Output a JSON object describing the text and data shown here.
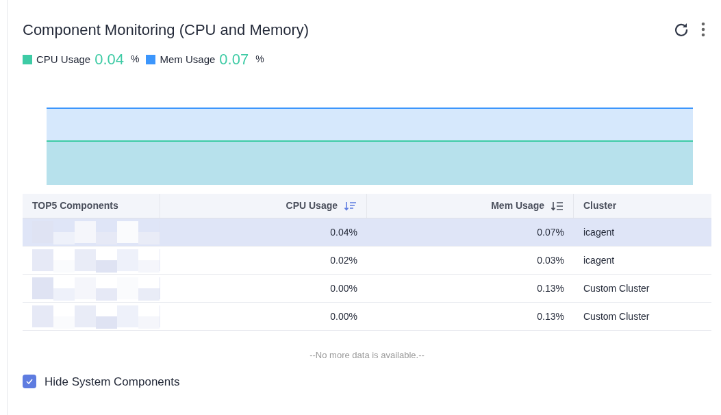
{
  "title": "Component Monitoring (CPU and Memory)",
  "legend": [
    {
      "label": "CPU Usage",
      "value": "0.04",
      "unit": "%",
      "color": "#3ecba5"
    },
    {
      "label": "Mem Usage",
      "value": "0.07",
      "unit": "%",
      "color": "#3c96fc"
    }
  ],
  "table": {
    "columns": [
      {
        "label": "TOP5 Components"
      },
      {
        "label": "CPU Usage",
        "sort_active": true
      },
      {
        "label": "Mem Usage",
        "sort_active": false
      },
      {
        "label": "Cluster"
      }
    ],
    "rows": [
      {
        "selected": true,
        "cells": [
          "0.04%",
          "0.07%",
          "icagent"
        ]
      },
      {
        "selected": false,
        "cells": [
          "0.02%",
          "0.03%",
          "icagent"
        ]
      },
      {
        "selected": false,
        "cells": [
          "0.00%",
          "0.13%",
          "Custom Cluster"
        ]
      },
      {
        "selected": false,
        "cells": [
          "0.00%",
          "0.13%",
          "Custom Cluster"
        ]
      }
    ]
  },
  "footer_note": "--No more data is available.--",
  "hide_system": {
    "label": "Hide System Components",
    "checked": true
  }
}
